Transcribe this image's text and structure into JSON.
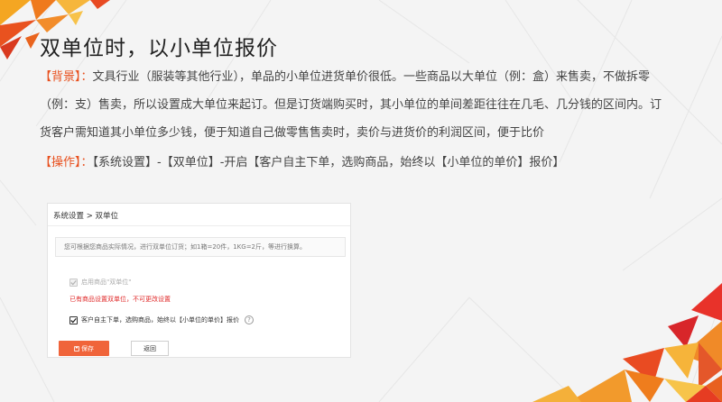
{
  "slide": {
    "title": "双单位时，以小单位报价",
    "background_tag": "【背景】：",
    "background_line1": "文具行业（服装等其他行业），单品的小单位进货单价很低。一些商品以大单位（例：盒）来售卖，不做拆零",
    "background_line2": "（例：支）售卖，所以设置成大单位来起订。但是订货端购买时，其小单位的单间差距往往在几毛、几分钱的区间内。订",
    "background_line3": "货客户需知道其小单位多少钱，便于知道自己做零售售卖时，卖价与进货价的利润区间，便于比价",
    "operation_tag": "【操作】：",
    "operation_text": "【系统设置】-【双单位】-开启【客户自主下单，选购商品，始终以【小单位的单价】报价】"
  },
  "screenshot": {
    "breadcrumb": "系统设置 > 双单位",
    "notice": "您可根据您商品实际情况，进行双单位订货；如1箱=20件，1KG=2斤，等进行换算。",
    "enable_dual_unit_label": "启用商品\"双单位\"",
    "enable_dual_unit_checked": true,
    "enable_dual_unit_disabled": true,
    "warning": "已有商品设置双单位，不可更改设置",
    "customer_order_label": "客户自主下单，选购商品，始终以【小单位的单价】报价",
    "customer_order_checked": true,
    "help_glyph": "?",
    "save_icon": "save-icon",
    "save_label": "保存",
    "back_label": "返回"
  },
  "colors": {
    "accent": "#e8501e",
    "save_button": "#f0643a",
    "warning": "#e02a2a"
  }
}
